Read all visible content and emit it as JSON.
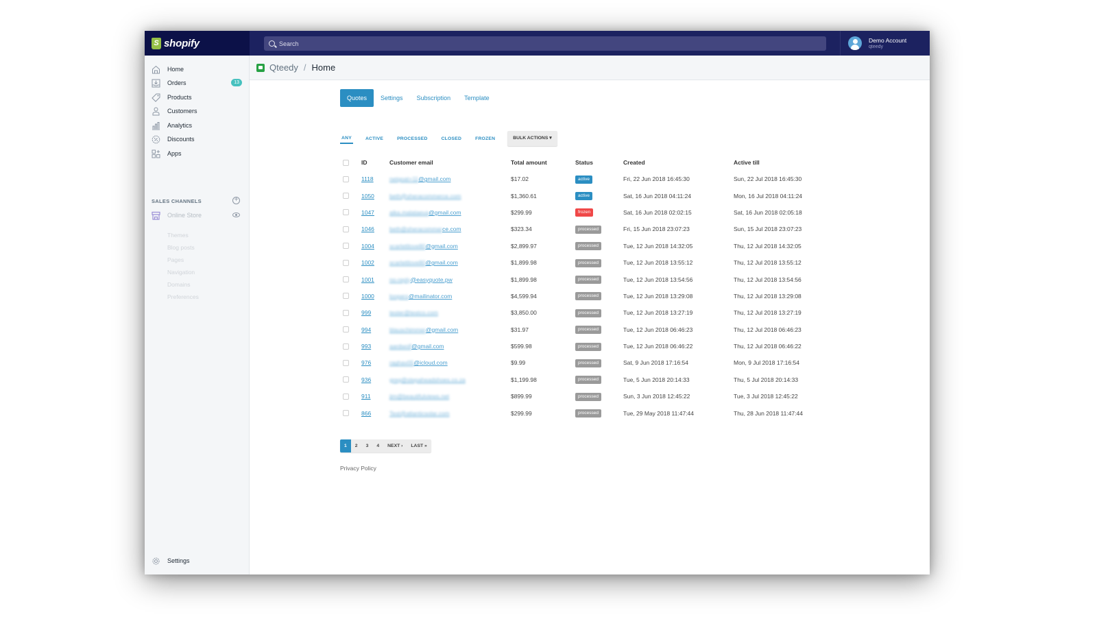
{
  "brand": {
    "name": "shopify"
  },
  "search": {
    "placeholder": "Search"
  },
  "account": {
    "name": "Demo Account",
    "shop": "qteedy"
  },
  "sidebar": {
    "items": [
      {
        "label": "Home",
        "icon": "home-icon"
      },
      {
        "label": "Orders",
        "icon": "orders-icon",
        "badge": "13"
      },
      {
        "label": "Products",
        "icon": "tag-icon"
      },
      {
        "label": "Customers",
        "icon": "person-icon"
      },
      {
        "label": "Analytics",
        "icon": "chart-icon"
      },
      {
        "label": "Discounts",
        "icon": "discount-icon"
      },
      {
        "label": "Apps",
        "icon": "apps-icon"
      }
    ],
    "sales_channels_title": "SALES CHANNELS",
    "online_store": "Online Store",
    "store_sub": [
      "Themes",
      "Blog posts",
      "Pages",
      "Navigation",
      "Domains",
      "Preferences"
    ],
    "settings": "Settings"
  },
  "breadcrumb": {
    "app": "Qteedy",
    "separator": "/",
    "current": "Home"
  },
  "tabs": [
    {
      "label": "Quotes",
      "active": true
    },
    {
      "label": "Settings",
      "active": false
    },
    {
      "label": "Subscription",
      "active": false
    },
    {
      "label": "Template",
      "active": false
    }
  ],
  "filters": [
    {
      "label": "ANY",
      "active": true
    },
    {
      "label": "ACTIVE",
      "active": false
    },
    {
      "label": "PROCESSED",
      "active": false
    },
    {
      "label": "CLOSED",
      "active": false
    },
    {
      "label": "FROZEN",
      "active": false
    }
  ],
  "bulk_actions": "BULK ACTIONS ▾",
  "table": {
    "headers": [
      "ID",
      "Customer email",
      "Total amount",
      "Status",
      "Created",
      "Active till"
    ],
    "rows": [
      {
        "id": "1118",
        "email_hidden": "netgoat+11",
        "email_domain": "@gmail.com",
        "amount": "$17.02",
        "status": "active",
        "created": "Fri, 22 Jun 2018 16:45:30",
        "active_till": "Sun, 22 Jul 2018 16:45:30"
      },
      {
        "id": "1050",
        "email_hidden": "beth@sheracommerce.com",
        "email_domain": "",
        "amount": "$1,360.61",
        "status": "active",
        "created": "Sat, 16 Jun 2018 04:11:24",
        "active_till": "Mon, 16 Jul 2018 04:11:24"
      },
      {
        "id": "1047",
        "email_hidden": "aika.malataeva",
        "email_domain": "@gmail.com",
        "amount": "$299.99",
        "status": "frozen",
        "created": "Sat, 16 Jun 2018 02:02:15",
        "active_till": "Sat, 16 Jun 2018 02:05:18"
      },
      {
        "id": "1046",
        "email_hidden": "beth@sheracommer",
        "email_domain": "ce.com",
        "amount": "$323.34",
        "status": "processed",
        "created": "Fri, 15 Jun 2018 23:07:23",
        "active_till": "Sun, 15 Jul 2018 23:07:23"
      },
      {
        "id": "1004",
        "email_hidden": "scarlettlove80",
        "email_domain": "@gmail.com",
        "amount": "$2,899.97",
        "status": "processed",
        "created": "Tue, 12 Jun 2018 14:32:05",
        "active_till": "Thu, 12 Jul 2018 14:32:05"
      },
      {
        "id": "1002",
        "email_hidden": "scarlettlove80",
        "email_domain": "@gmail.com",
        "amount": "$1,899.98",
        "status": "processed",
        "created": "Tue, 12 Jun 2018 13:55:12",
        "active_till": "Thu, 12 Jul 2018 13:55:12"
      },
      {
        "id": "1001",
        "email_hidden": "no-reply",
        "email_domain": "@easyquote.pw",
        "amount": "$1,899.98",
        "status": "processed",
        "created": "Tue, 12 Jun 2018 13:54:56",
        "active_till": "Thu, 12 Jul 2018 13:54:56"
      },
      {
        "id": "1000",
        "email_hidden": "loopers",
        "email_domain": "@mailinator.com",
        "amount": "$4,599.94",
        "status": "processed",
        "created": "Tue, 12 Jun 2018 13:29:08",
        "active_till": "Thu, 12 Jul 2018 13:29:08"
      },
      {
        "id": "999",
        "email_hidden": "tester@testco.com",
        "email_domain": "",
        "amount": "$3,850.00",
        "status": "processed",
        "created": "Tue, 12 Jun 2018 13:27:19",
        "active_till": "Thu, 12 Jul 2018 13:27:19"
      },
      {
        "id": "994",
        "email_hidden": "blauschimmer",
        "email_domain": "@gmail.com",
        "amount": "$31.97",
        "status": "processed",
        "created": "Tue, 12 Jun 2018 06:46:23",
        "active_till": "Thu, 12 Jul 2018 06:46:23"
      },
      {
        "id": "993",
        "email_hidden": "aardwolf",
        "email_domain": "@gmail.com",
        "amount": "$599.98",
        "status": "processed",
        "created": "Tue, 12 Jun 2018 06:46:22",
        "active_till": "Thu, 12 Jul 2018 06:46:22"
      },
      {
        "id": "976",
        "email_hidden": "raghav05",
        "email_domain": "@icloud.com",
        "amount": "$9.99",
        "status": "processed",
        "created": "Sat, 9 Jun 2018 17:16:54",
        "active_till": "Mon, 9 Jul 2018 17:16:54"
      },
      {
        "id": "936",
        "email_hidden": "greg@stepaheadshoes.co.za",
        "email_domain": "",
        "amount": "$1,199.98",
        "status": "processed",
        "created": "Tue, 5 Jun 2018 20:14:33",
        "active_till": "Thu, 5 Jul 2018 20:14:33"
      },
      {
        "id": "911",
        "email_hidden": "jim@beautifulviews.net",
        "email_domain": "",
        "amount": "$899.99",
        "status": "processed",
        "created": "Sun, 3 Jun 2018 12:45:22",
        "active_till": "Tue, 3 Jul 2018 12:45:22"
      },
      {
        "id": "866",
        "email_hidden": "Test@atlanticsolar.com",
        "email_domain": "",
        "amount": "$299.99",
        "status": "processed",
        "created": "Tue, 29 May 2018 11:47:44",
        "active_till": "Thu, 28 Jun 2018 11:47:44"
      }
    ]
  },
  "status_colors": {
    "active": "#2b8ec2",
    "frozen": "#f04848",
    "processed": "#9a9a9a"
  },
  "pagination": {
    "pages": [
      "1",
      "2",
      "3",
      "4"
    ],
    "current": "1",
    "next": "NEXT ›",
    "last": "LAST »"
  },
  "footer": {
    "privacy": "Privacy Policy"
  }
}
